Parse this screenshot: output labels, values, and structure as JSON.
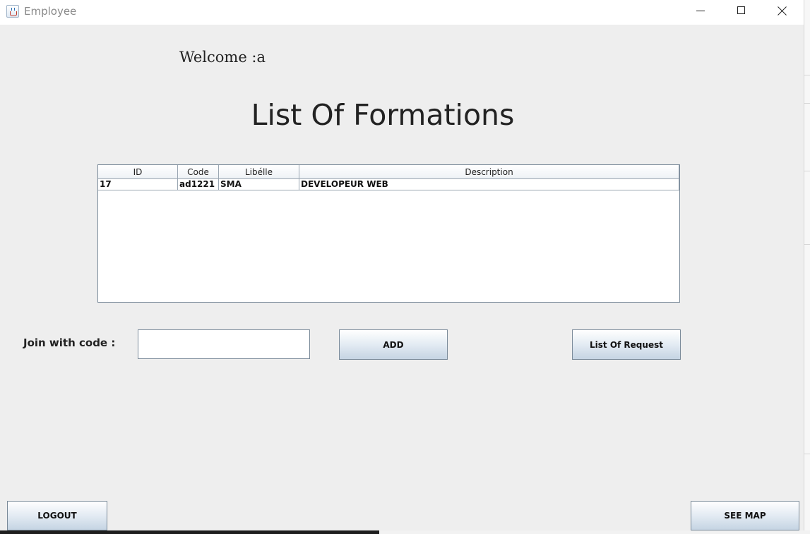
{
  "window": {
    "title": "Employee"
  },
  "welcome_text": "Welcome :a",
  "heading": "List Of Formations",
  "table": {
    "columns": [
      "ID",
      "Code",
      "Libélle",
      "Description"
    ],
    "rows": [
      [
        "17",
        "ad1221",
        "SMA",
        "DEVELOPEUR WEB"
      ]
    ]
  },
  "join": {
    "label": "Join with code :",
    "value": ""
  },
  "buttons": {
    "add": "ADD",
    "list_of_request": "List Of Request",
    "logout": "LOGOUT",
    "see_map": "SEE MAP"
  },
  "icons": {
    "app": "java-cup-icon",
    "minimize": "minimize-icon",
    "maximize": "maximize-icon",
    "close": "close-icon"
  }
}
